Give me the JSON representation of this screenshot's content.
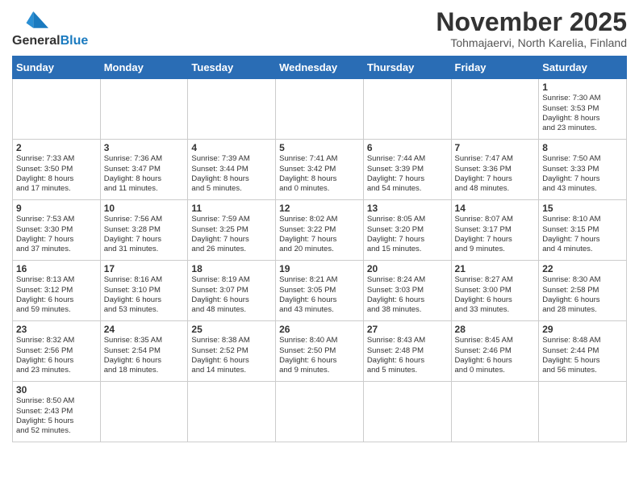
{
  "header": {
    "logo_general": "General",
    "logo_blue": "Blue",
    "month_title": "November 2025",
    "location": "Tohmajaervi, North Karelia, Finland"
  },
  "weekdays": [
    "Sunday",
    "Monday",
    "Tuesday",
    "Wednesday",
    "Thursday",
    "Friday",
    "Saturday"
  ],
  "weeks": [
    [
      {
        "day": "",
        "info": ""
      },
      {
        "day": "",
        "info": ""
      },
      {
        "day": "",
        "info": ""
      },
      {
        "day": "",
        "info": ""
      },
      {
        "day": "",
        "info": ""
      },
      {
        "day": "",
        "info": ""
      },
      {
        "day": "1",
        "info": "Sunrise: 7:30 AM\nSunset: 3:53 PM\nDaylight: 8 hours\nand 23 minutes."
      }
    ],
    [
      {
        "day": "2",
        "info": "Sunrise: 7:33 AM\nSunset: 3:50 PM\nDaylight: 8 hours\nand 17 minutes."
      },
      {
        "day": "3",
        "info": "Sunrise: 7:36 AM\nSunset: 3:47 PM\nDaylight: 8 hours\nand 11 minutes."
      },
      {
        "day": "4",
        "info": "Sunrise: 7:39 AM\nSunset: 3:44 PM\nDaylight: 8 hours\nand 5 minutes."
      },
      {
        "day": "5",
        "info": "Sunrise: 7:41 AM\nSunset: 3:42 PM\nDaylight: 8 hours\nand 0 minutes."
      },
      {
        "day": "6",
        "info": "Sunrise: 7:44 AM\nSunset: 3:39 PM\nDaylight: 7 hours\nand 54 minutes."
      },
      {
        "day": "7",
        "info": "Sunrise: 7:47 AM\nSunset: 3:36 PM\nDaylight: 7 hours\nand 48 minutes."
      },
      {
        "day": "8",
        "info": "Sunrise: 7:50 AM\nSunset: 3:33 PM\nDaylight: 7 hours\nand 43 minutes."
      }
    ],
    [
      {
        "day": "9",
        "info": "Sunrise: 7:53 AM\nSunset: 3:30 PM\nDaylight: 7 hours\nand 37 minutes."
      },
      {
        "day": "10",
        "info": "Sunrise: 7:56 AM\nSunset: 3:28 PM\nDaylight: 7 hours\nand 31 minutes."
      },
      {
        "day": "11",
        "info": "Sunrise: 7:59 AM\nSunset: 3:25 PM\nDaylight: 7 hours\nand 26 minutes."
      },
      {
        "day": "12",
        "info": "Sunrise: 8:02 AM\nSunset: 3:22 PM\nDaylight: 7 hours\nand 20 minutes."
      },
      {
        "day": "13",
        "info": "Sunrise: 8:05 AM\nSunset: 3:20 PM\nDaylight: 7 hours\nand 15 minutes."
      },
      {
        "day": "14",
        "info": "Sunrise: 8:07 AM\nSunset: 3:17 PM\nDaylight: 7 hours\nand 9 minutes."
      },
      {
        "day": "15",
        "info": "Sunrise: 8:10 AM\nSunset: 3:15 PM\nDaylight: 7 hours\nand 4 minutes."
      }
    ],
    [
      {
        "day": "16",
        "info": "Sunrise: 8:13 AM\nSunset: 3:12 PM\nDaylight: 6 hours\nand 59 minutes."
      },
      {
        "day": "17",
        "info": "Sunrise: 8:16 AM\nSunset: 3:10 PM\nDaylight: 6 hours\nand 53 minutes."
      },
      {
        "day": "18",
        "info": "Sunrise: 8:19 AM\nSunset: 3:07 PM\nDaylight: 6 hours\nand 48 minutes."
      },
      {
        "day": "19",
        "info": "Sunrise: 8:21 AM\nSunset: 3:05 PM\nDaylight: 6 hours\nand 43 minutes."
      },
      {
        "day": "20",
        "info": "Sunrise: 8:24 AM\nSunset: 3:03 PM\nDaylight: 6 hours\nand 38 minutes."
      },
      {
        "day": "21",
        "info": "Sunrise: 8:27 AM\nSunset: 3:00 PM\nDaylight: 6 hours\nand 33 minutes."
      },
      {
        "day": "22",
        "info": "Sunrise: 8:30 AM\nSunset: 2:58 PM\nDaylight: 6 hours\nand 28 minutes."
      }
    ],
    [
      {
        "day": "23",
        "info": "Sunrise: 8:32 AM\nSunset: 2:56 PM\nDaylight: 6 hours\nand 23 minutes."
      },
      {
        "day": "24",
        "info": "Sunrise: 8:35 AM\nSunset: 2:54 PM\nDaylight: 6 hours\nand 18 minutes."
      },
      {
        "day": "25",
        "info": "Sunrise: 8:38 AM\nSunset: 2:52 PM\nDaylight: 6 hours\nand 14 minutes."
      },
      {
        "day": "26",
        "info": "Sunrise: 8:40 AM\nSunset: 2:50 PM\nDaylight: 6 hours\nand 9 minutes."
      },
      {
        "day": "27",
        "info": "Sunrise: 8:43 AM\nSunset: 2:48 PM\nDaylight: 6 hours\nand 5 minutes."
      },
      {
        "day": "28",
        "info": "Sunrise: 8:45 AM\nSunset: 2:46 PM\nDaylight: 6 hours\nand 0 minutes."
      },
      {
        "day": "29",
        "info": "Sunrise: 8:48 AM\nSunset: 2:44 PM\nDaylight: 5 hours\nand 56 minutes."
      }
    ],
    [
      {
        "day": "30",
        "info": "Sunrise: 8:50 AM\nSunset: 2:43 PM\nDaylight: 5 hours\nand 52 minutes."
      },
      {
        "day": "",
        "info": ""
      },
      {
        "day": "",
        "info": ""
      },
      {
        "day": "",
        "info": ""
      },
      {
        "day": "",
        "info": ""
      },
      {
        "day": "",
        "info": ""
      },
      {
        "day": "",
        "info": ""
      }
    ]
  ]
}
